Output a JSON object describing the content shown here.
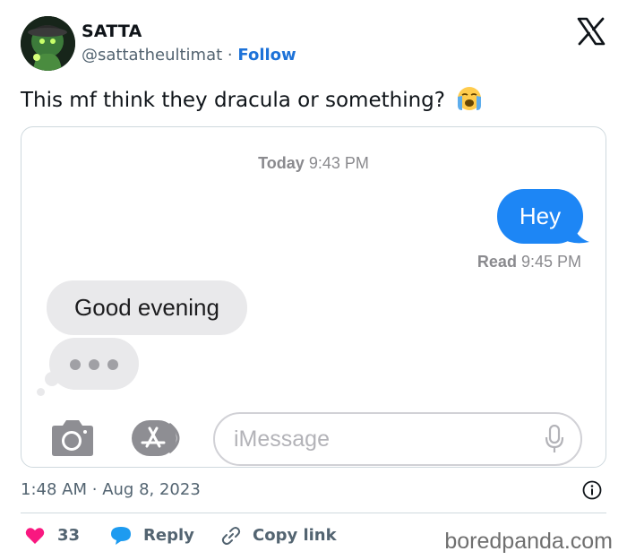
{
  "author": {
    "name": "SATTA",
    "handle": "@sattatheultimat",
    "separator": "·",
    "follow_label": "Follow"
  },
  "platform_icon": "x-logo-icon",
  "tweet": {
    "text": "This mf think they dracula or something?",
    "emoji": "loudly-crying-face-icon"
  },
  "screenshot": {
    "timestamp_bold": "Today",
    "timestamp_time": "9:43 PM",
    "sent_message": "Hey",
    "read_bold": "Read",
    "read_time": "9:45 PM",
    "received_message": "Good evening",
    "input_placeholder": "iMessage",
    "colors": {
      "sent_bubble": "#1d86f5",
      "received_bubble": "#e9e9eb"
    }
  },
  "meta": {
    "time": "1:48 AM",
    "separator": "·",
    "date": "Aug 8, 2023"
  },
  "actions": {
    "like_count": "33",
    "reply_label": "Reply",
    "copy_link_label": "Copy link",
    "colors": {
      "like": "#f91880",
      "reply": "#1d9bf0"
    }
  },
  "watermark": "boredpanda.com"
}
